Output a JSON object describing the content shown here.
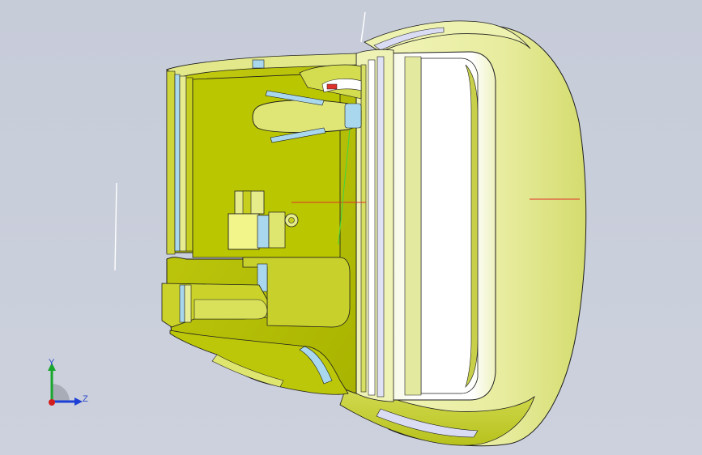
{
  "viewport": {
    "background_top": "#c7ccd9",
    "background_bottom": "#ccd1dd"
  },
  "model": {
    "shell_color": "#e6ec9a",
    "shell_shade": "#b8c400",
    "lens_color": "#ffffff",
    "accent_blue": "#a9d8ee",
    "accent_red": "#e0302a",
    "edge_color": "#1e1e1e"
  },
  "triad": {
    "y_label": "Y",
    "z_label": "Z",
    "y_color": "#19a62c",
    "z_color": "#1e3fd6",
    "x_color": "#d31c1c"
  }
}
